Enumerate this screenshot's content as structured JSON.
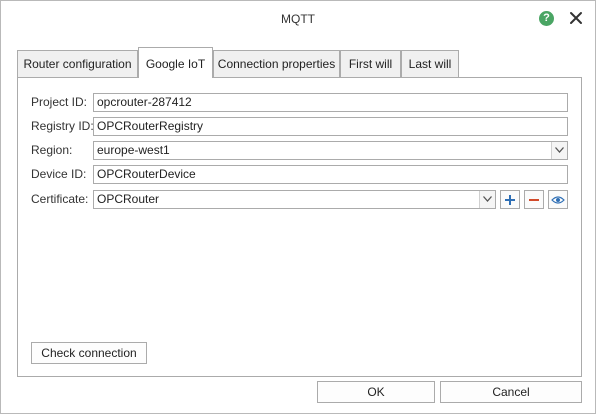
{
  "window": {
    "title": "MQTT",
    "help_glyph": "?",
    "accent_help": "#4aa564"
  },
  "tabs": [
    {
      "label": "Router configuration",
      "active": false
    },
    {
      "label": "Google IoT",
      "active": true
    },
    {
      "label": "Connection properties",
      "active": false
    },
    {
      "label": "First will",
      "active": false
    },
    {
      "label": "Last will",
      "active": false
    }
  ],
  "form": {
    "project_id": {
      "label": "Project ID:",
      "value": "opcrouter-287412"
    },
    "registry_id": {
      "label": "Registry ID:",
      "value": "OPCRouterRegistry"
    },
    "region": {
      "label": "Region:",
      "value": "europe-west1"
    },
    "device_id": {
      "label": "Device ID:",
      "value": "OPCRouterDevice"
    },
    "certificate": {
      "label": "Certificate:",
      "value": "OPCRouter"
    }
  },
  "icons": {
    "add": "plus-icon",
    "remove": "minus-icon",
    "view": "eye-icon",
    "add_color": "#2f6fb5",
    "remove_color": "#d24a2a"
  },
  "buttons": {
    "check_connection": "Check connection",
    "ok": "OK",
    "cancel": "Cancel"
  }
}
